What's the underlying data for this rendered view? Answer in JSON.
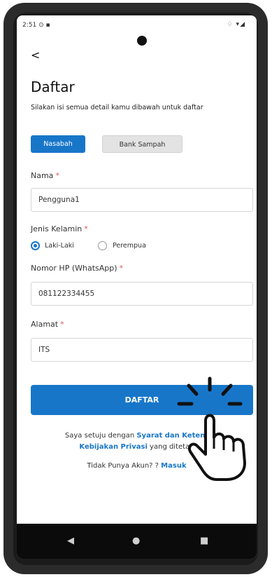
{
  "status": {
    "time": "2:51",
    "left_icons": "⊙ ▪",
    "right_icons": "♢ ▾◢"
  },
  "nav": {
    "back_label": "<"
  },
  "page": {
    "title": "Daftar",
    "subtitle": "Silakan isi semua detail kamu dibawah untuk daftar"
  },
  "tabs": [
    {
      "label": "Nasabah",
      "active": true
    },
    {
      "label": "Bank Sampah",
      "active": false
    }
  ],
  "form": {
    "name": {
      "label": "Nama",
      "required_mark": "*",
      "value": "Pengguna1"
    },
    "gender": {
      "label": "Jenis Kelamin",
      "required_mark": "*",
      "options": [
        {
          "label": "Laki-Laki",
          "selected": true
        },
        {
          "label": "Perempua",
          "selected": false
        }
      ]
    },
    "phone": {
      "label": "Nomor HP (WhatsApp)",
      "required_mark": "*",
      "value": "081122334455"
    },
    "address": {
      "label": "Alamat",
      "required_mark": "*",
      "value": "ITS"
    },
    "submit_label": "DAFTAR"
  },
  "agreement": {
    "prefix": "Saya setuju dengan ",
    "terms_link": "Syarat dan Ketent",
    "policy_link": "Kebijakan Privasi",
    "suffix": " yang ditetap"
  },
  "login": {
    "prompt": "Tidak Punya Akun? ? ",
    "link_label": "Masuk"
  },
  "system_nav": {
    "back_icon": "◀",
    "home_icon": "●",
    "recents_icon": "■"
  },
  "colors": {
    "accent": "#1876c9",
    "required": "#e0585b"
  }
}
